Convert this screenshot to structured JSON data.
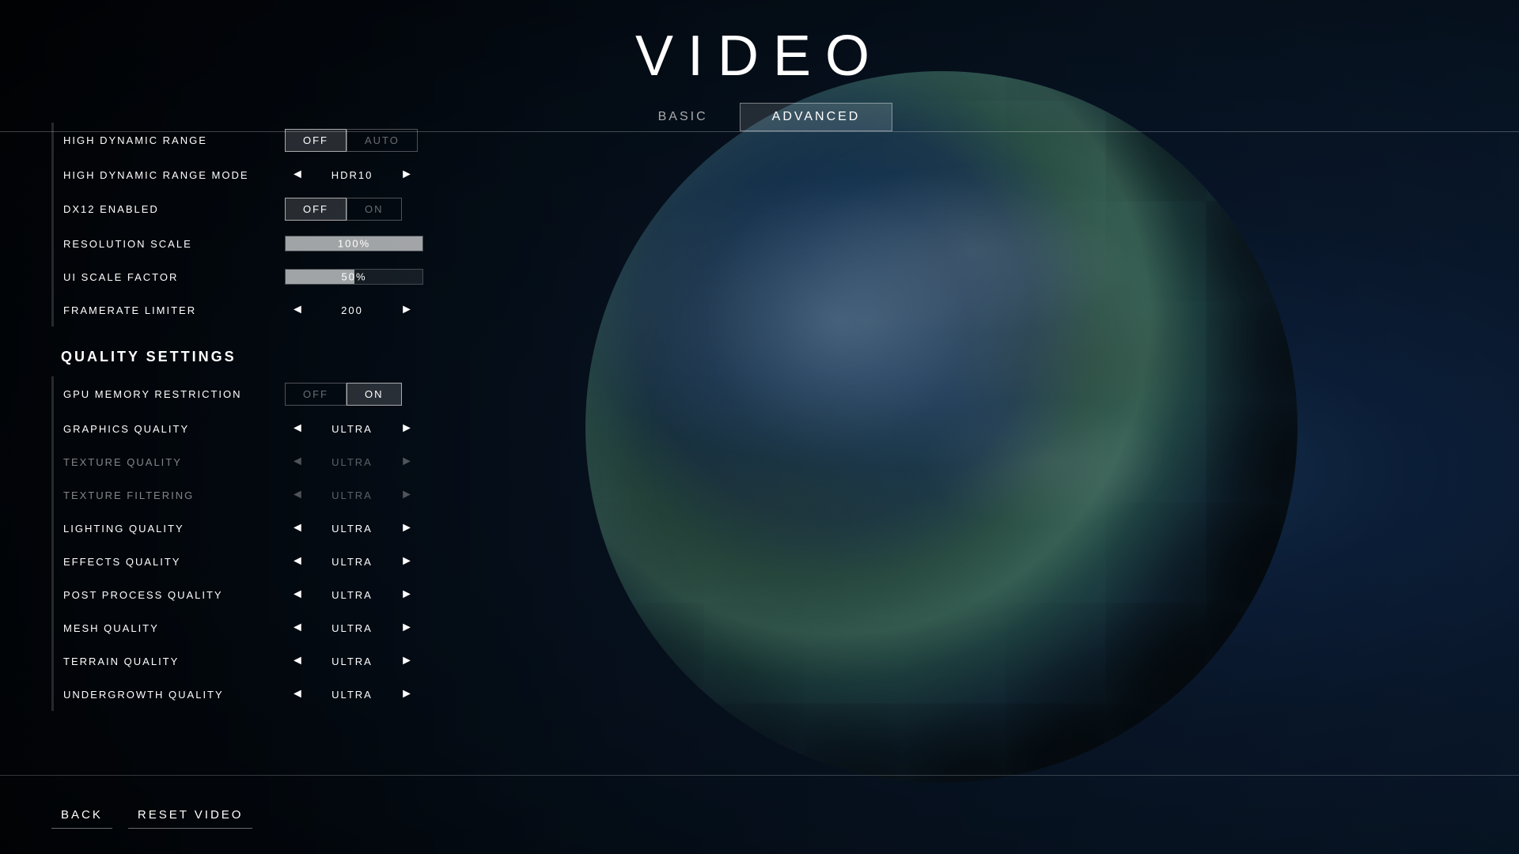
{
  "page": {
    "title": "VIDEO",
    "tabs": [
      {
        "id": "basic",
        "label": "BASIC",
        "active": false
      },
      {
        "id": "advanced",
        "label": "ADVANCED",
        "active": true
      }
    ]
  },
  "settings": {
    "items": [
      {
        "id": "high-dynamic-range",
        "label": "HIGH DYNAMIC RANGE",
        "type": "toggle",
        "options": [
          "OFF",
          "AUTO"
        ],
        "value": "OFF"
      },
      {
        "id": "high-dynamic-range-mode",
        "label": "HIGH DYNAMIC RANGE MODE",
        "type": "arrow-select",
        "value": "HDR10"
      },
      {
        "id": "dx12-enabled",
        "label": "DX12 ENABLED",
        "type": "toggle",
        "options": [
          "OFF",
          "ON"
        ],
        "value": "OFF"
      },
      {
        "id": "resolution-scale",
        "label": "RESOLUTION SCALE",
        "type": "slider",
        "value": "100%",
        "fill": 100
      },
      {
        "id": "ui-scale-factor",
        "label": "UI SCALE FACTOR",
        "type": "slider",
        "value": "50%",
        "fill": 50
      },
      {
        "id": "framerate-limiter",
        "label": "FRAMERATE LIMITER",
        "type": "arrow-select",
        "value": "200"
      }
    ],
    "quality_section": {
      "title": "QUALITY SETTINGS",
      "items": [
        {
          "id": "gpu-memory-restriction",
          "label": "GPU MEMORY RESTRICTION",
          "type": "toggle",
          "options": [
            "OFF",
            "ON"
          ],
          "value": "ON"
        },
        {
          "id": "graphics-quality",
          "label": "GRAPHICS QUALITY",
          "type": "arrow-select",
          "value": "ULTRA",
          "muted": false
        },
        {
          "id": "texture-quality",
          "label": "TEXTURE QUALITY",
          "type": "arrow-select",
          "value": "ULTRA",
          "muted": true
        },
        {
          "id": "texture-filtering",
          "label": "TEXTURE FILTERING",
          "type": "arrow-select",
          "value": "ULTRA",
          "muted": true
        },
        {
          "id": "lighting-quality",
          "label": "LIGHTING QUALITY",
          "type": "arrow-select",
          "value": "ULTRA",
          "muted": false
        },
        {
          "id": "effects-quality",
          "label": "EFFECTS QUALITY",
          "type": "arrow-select",
          "value": "ULTRA",
          "muted": false
        },
        {
          "id": "post-process-quality",
          "label": "POST PROCESS QUALITY",
          "type": "arrow-select",
          "value": "ULTRA",
          "muted": false
        },
        {
          "id": "mesh-quality",
          "label": "MESH QUALITY",
          "type": "arrow-select",
          "value": "ULTRA",
          "muted": false
        },
        {
          "id": "terrain-quality",
          "label": "TERRAIN QUALITY",
          "type": "arrow-select",
          "value": "ULTRA",
          "muted": false
        },
        {
          "id": "undergrowth-quality",
          "label": "UNDERGROWTH QUALITY",
          "type": "arrow-select",
          "value": "ULTRA",
          "muted": false
        }
      ]
    }
  },
  "footer": {
    "back_label": "BACK",
    "reset_label": "RESET VIDEO"
  },
  "icons": {
    "arrow_left": "◄",
    "arrow_right": "►"
  }
}
